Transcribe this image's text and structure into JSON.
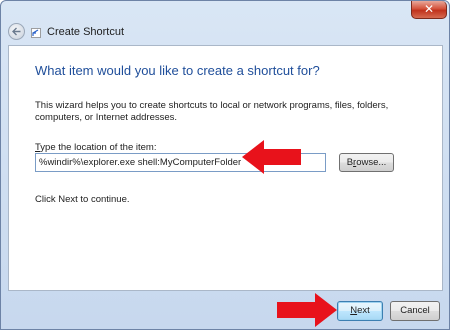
{
  "window": {
    "title": "Create Shortcut",
    "close_label": "✕"
  },
  "wizard": {
    "heading": "What item would you like to create a shortcut for?",
    "description": "This wizard helps you to create shortcuts to local or network programs, files, folders, computers, or Internet addresses.",
    "location_label_accel": "T",
    "location_label_rest": "ype the location of the item:",
    "location_value": "%windir%\\explorer.exe shell:MyComputerFolder",
    "browse_accel": "r",
    "browse_pre": "B",
    "browse_post": "owse...",
    "continue_text": "Click Next to continue."
  },
  "buttons": {
    "next_accel": "N",
    "next_rest": "ext",
    "cancel": "Cancel"
  },
  "colors": {
    "heading": "#1f4e9a",
    "arrow": "#e8121b"
  },
  "icons": {
    "back": "back-arrow-icon",
    "wizard": "shortcut-icon",
    "annotation": "red-arrow-icon"
  }
}
